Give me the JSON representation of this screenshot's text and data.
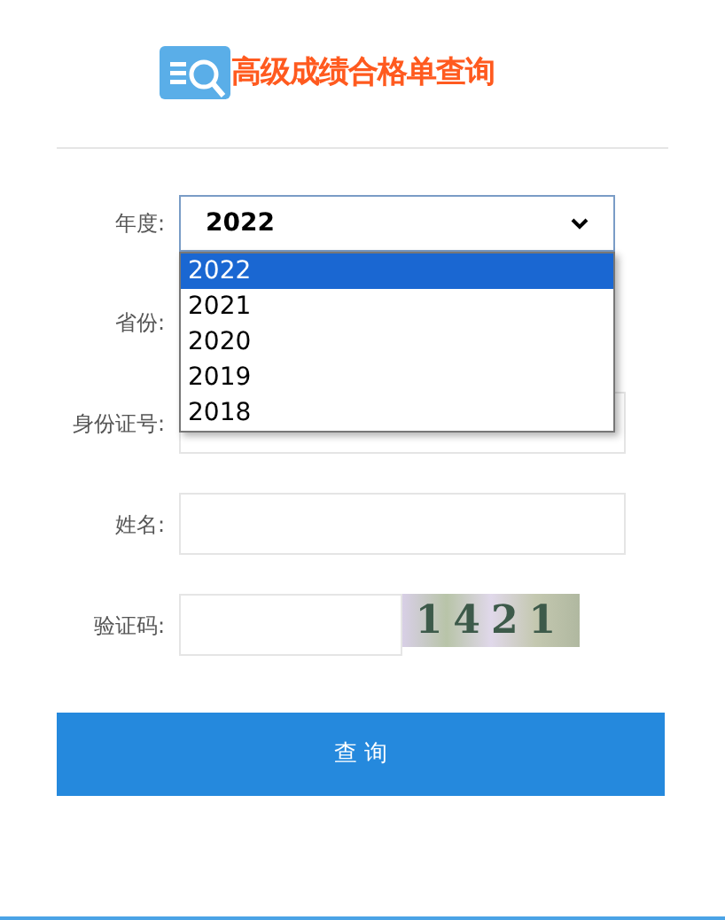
{
  "header": {
    "title": "高级成绩合格单查询"
  },
  "form": {
    "year": {
      "label": "年度:",
      "value": "2022",
      "options": [
        {
          "label": "2022",
          "selected": true
        },
        {
          "label": "2021",
          "selected": false
        },
        {
          "label": "2020",
          "selected": false
        },
        {
          "label": "2019",
          "selected": false
        },
        {
          "label": "2018",
          "selected": false
        }
      ]
    },
    "province": {
      "label": "省份:"
    },
    "id_number": {
      "label": "身份证号:"
    },
    "name": {
      "label": "姓名:"
    },
    "captcha": {
      "label": "验证码:",
      "code": "1421"
    }
  },
  "submit_button": "查 询"
}
